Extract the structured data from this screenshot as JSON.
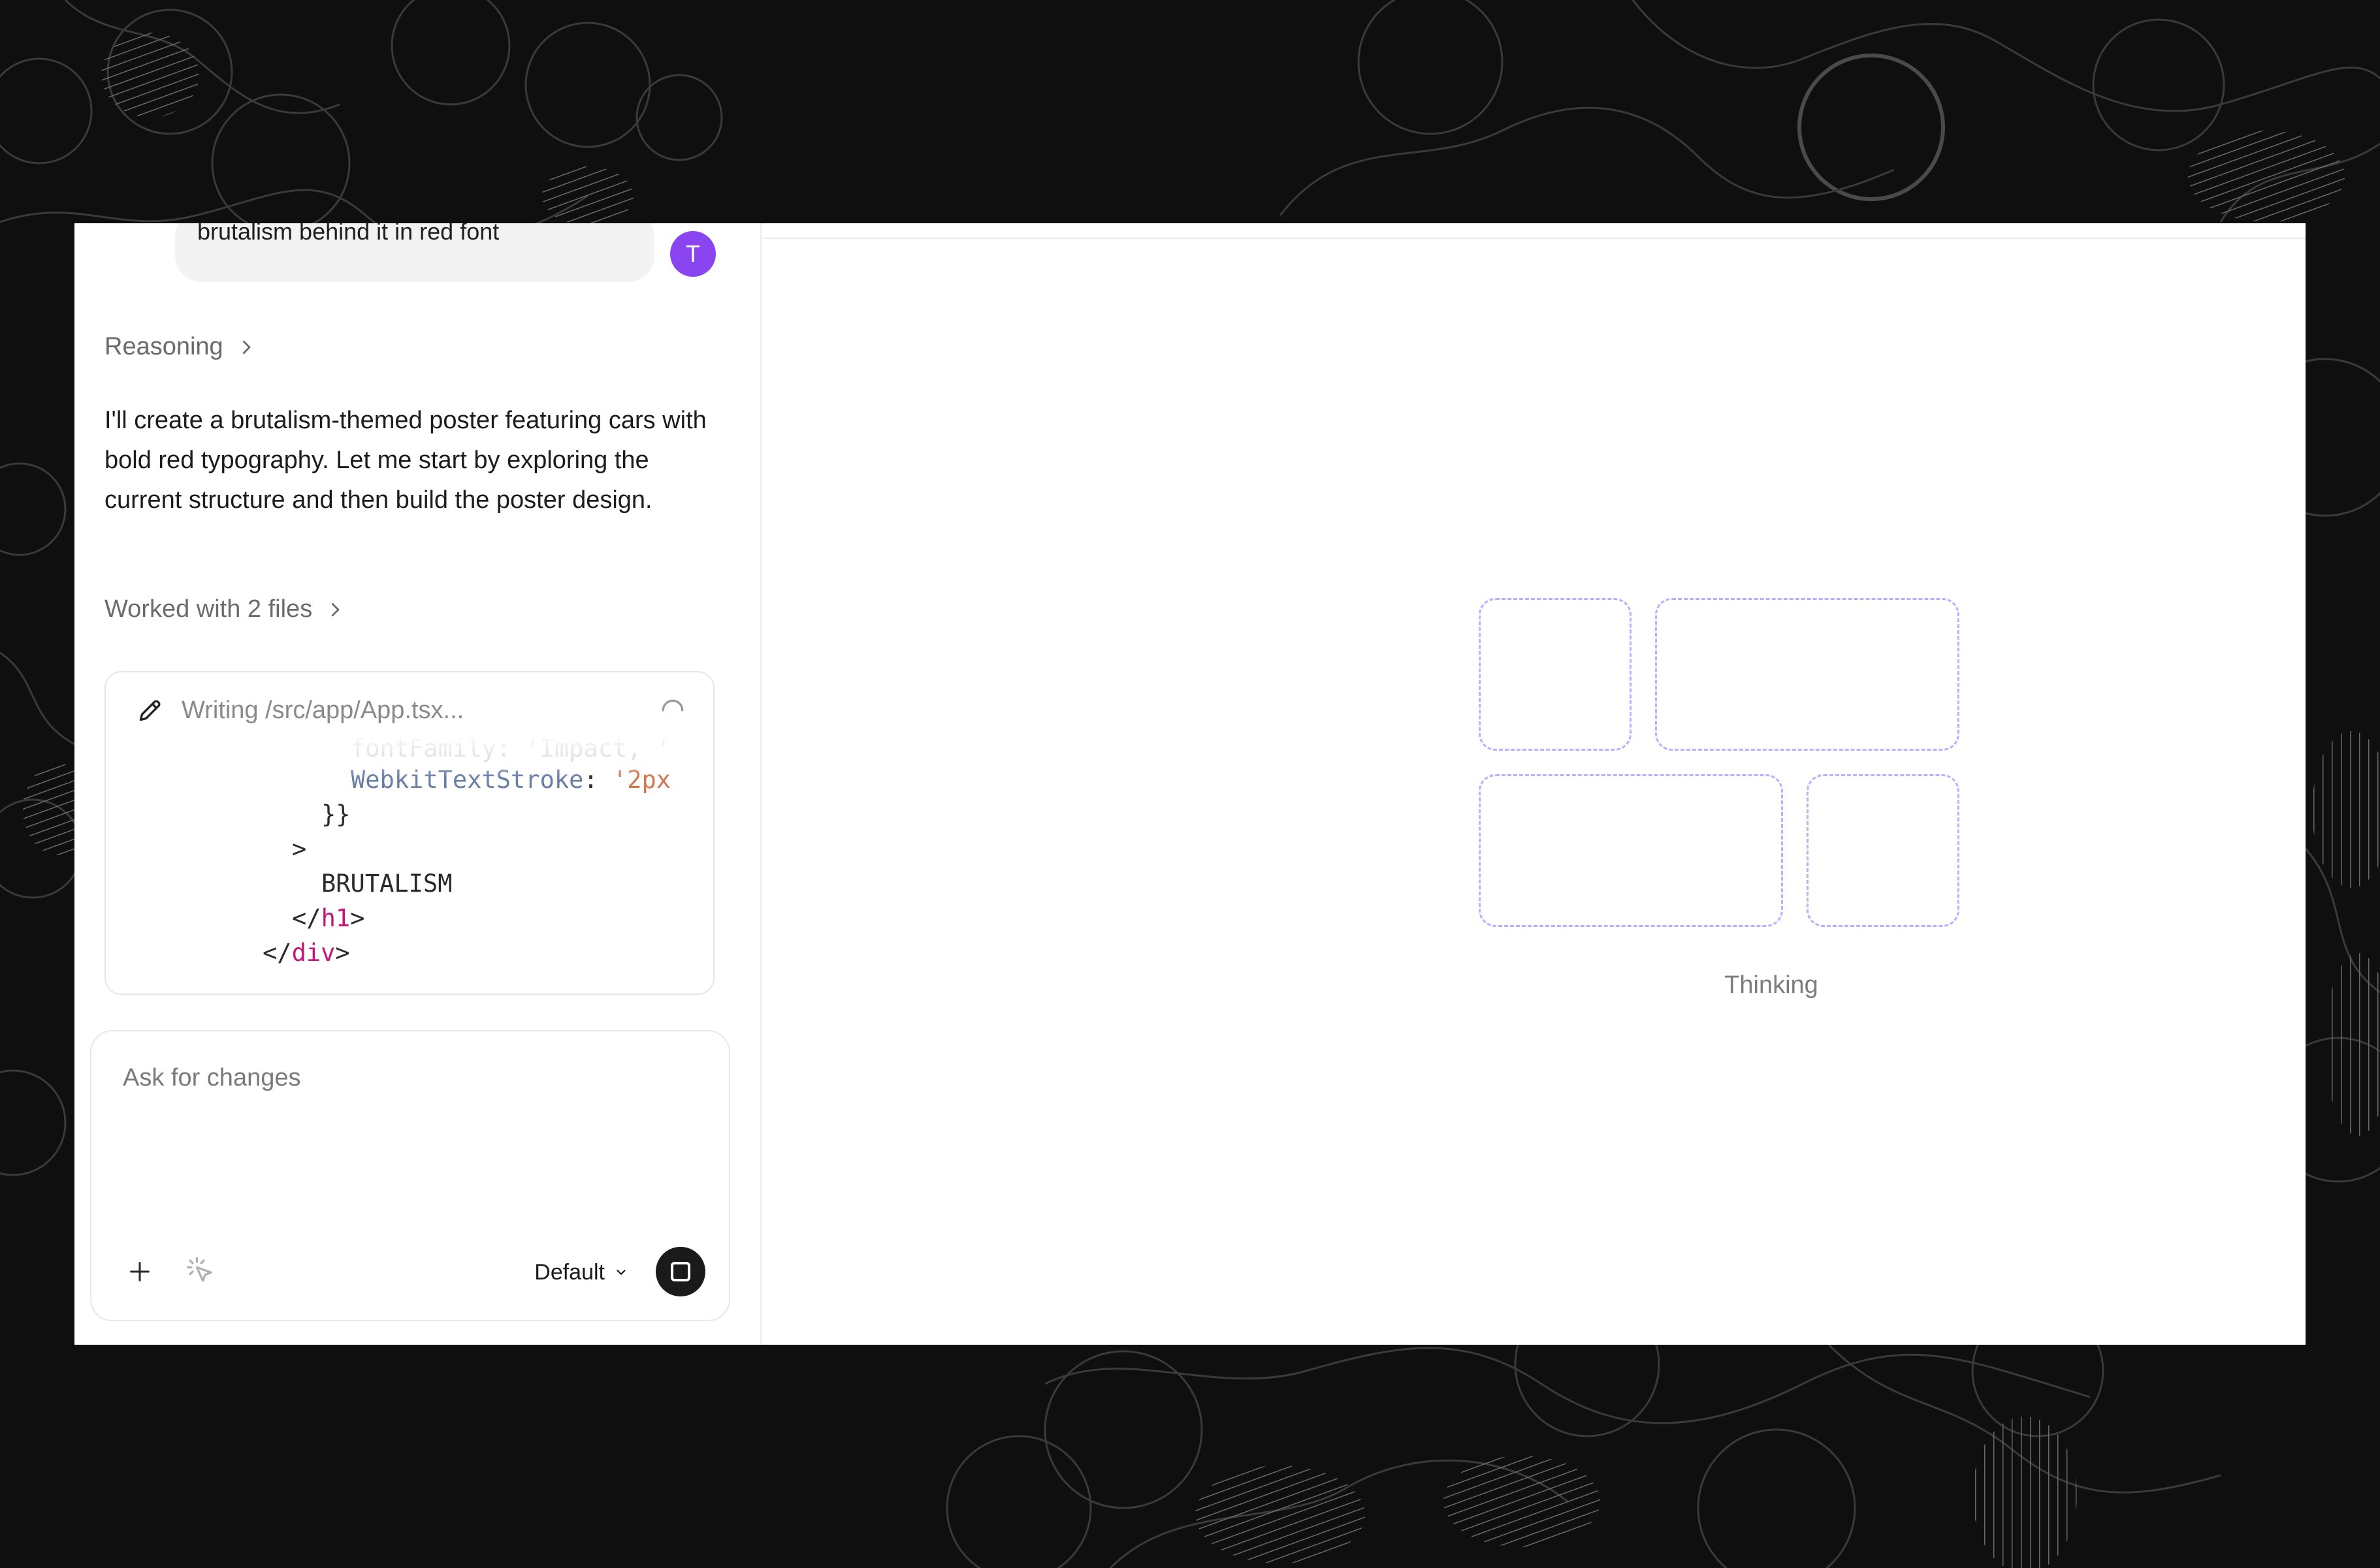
{
  "chat": {
    "user_message": "brutalism behind it in red font",
    "avatar_initial": "T",
    "reasoning_label": "Reasoning",
    "assistant_message": "I'll create a brutalism-themed poster featuring cars with bold red typography. Let me start by exploring the current structure and then build the poster design.",
    "worked_label": "Worked with 2 files",
    "code_card": {
      "title": "Writing /src/app/App.tsx...",
      "lines": {
        "l0_a": "fontFamily: 'Impact, '",
        "l1_prop": "WebkitTextStroke",
        "l1_colon": ": ",
        "l1_str": "'2px",
        "l2": "}}",
        "l3": ">",
        "l4": "BRUTALISM",
        "l5_open": "</",
        "l5_tag": "h1",
        "l5_close": ">",
        "l6_open": "</",
        "l6_tag": "div",
        "l6_close": ">"
      }
    },
    "input": {
      "placeholder": "Ask for changes",
      "mode_label": "Default"
    }
  },
  "preview": {
    "status_label": "Thinking"
  },
  "colors": {
    "avatar": "#8b45f0",
    "skeleton_border": "#b9b1ff",
    "code_tag": "#c2187a",
    "code_prop": "#6a7fa6",
    "code_string": "#d2764e"
  }
}
